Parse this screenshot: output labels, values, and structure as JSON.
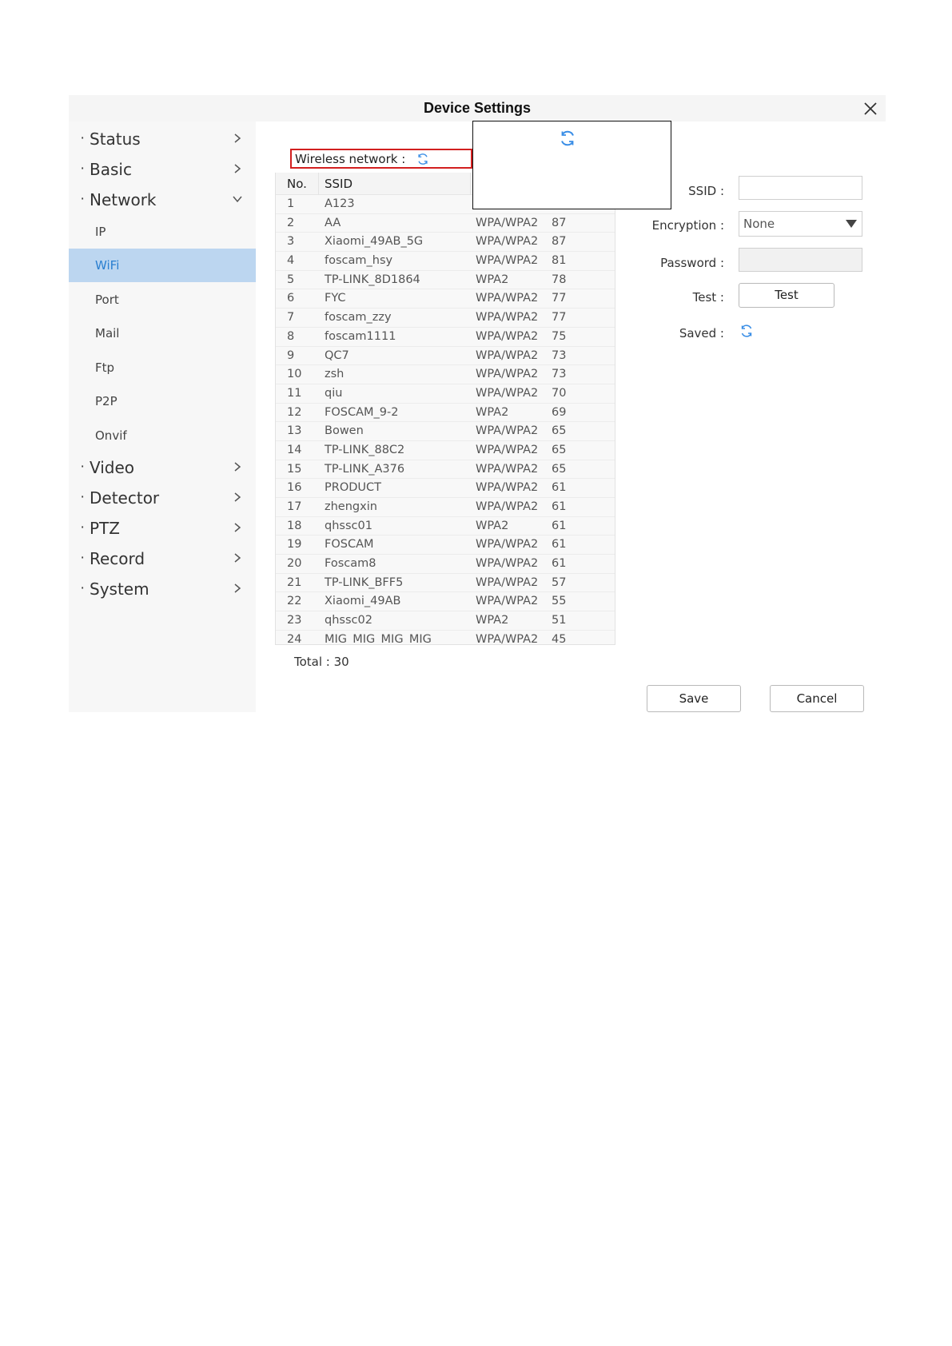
{
  "window": {
    "title": "Device Settings"
  },
  "sidebar": {
    "items": [
      {
        "label": "Status"
      },
      {
        "label": "Basic"
      },
      {
        "label": "Network"
      },
      {
        "label": "Video"
      },
      {
        "label": "Detector"
      },
      {
        "label": "PTZ"
      },
      {
        "label": "Record"
      },
      {
        "label": "System"
      }
    ],
    "network_sub": [
      {
        "label": "IP"
      },
      {
        "label": "WiFi"
      },
      {
        "label": "Port"
      },
      {
        "label": "Mail"
      },
      {
        "label": "Ftp"
      },
      {
        "label": "P2P"
      },
      {
        "label": "Onvif"
      }
    ]
  },
  "wifi": {
    "wireless_label": "Wireless network :",
    "table": {
      "headers": {
        "no": "No.",
        "ssid": "SSID"
      },
      "rows": [
        {
          "no": "1",
          "ssid": "A123",
          "enc": "",
          "sig": ""
        },
        {
          "no": "2",
          "ssid": "AA",
          "enc": "WPA/WPA2",
          "sig": "87"
        },
        {
          "no": "3",
          "ssid": "Xiaomi_49AB_5G",
          "enc": "WPA/WPA2",
          "sig": "87"
        },
        {
          "no": "4",
          "ssid": "foscam_hsy",
          "enc": "WPA/WPA2",
          "sig": "81"
        },
        {
          "no": "5",
          "ssid": "TP-LINK_8D1864",
          "enc": "WPA2",
          "sig": "78"
        },
        {
          "no": "6",
          "ssid": "FYC",
          "enc": "WPA/WPA2",
          "sig": "77"
        },
        {
          "no": "7",
          "ssid": "foscam_zzy",
          "enc": "WPA/WPA2",
          "sig": "77"
        },
        {
          "no": "8",
          "ssid": "foscam1111",
          "enc": "WPA/WPA2",
          "sig": "75"
        },
        {
          "no": "9",
          "ssid": "QC7",
          "enc": "WPA/WPA2",
          "sig": "73"
        },
        {
          "no": "10",
          "ssid": "zsh",
          "enc": "WPA/WPA2",
          "sig": "73"
        },
        {
          "no": "11",
          "ssid": "qiu",
          "enc": "WPA/WPA2",
          "sig": "70"
        },
        {
          "no": "12",
          "ssid": "FOSCAM_9-2",
          "enc": "WPA2",
          "sig": "69"
        },
        {
          "no": "13",
          "ssid": "Bowen",
          "enc": "WPA/WPA2",
          "sig": "65"
        },
        {
          "no": "14",
          "ssid": "TP-LINK_88C2",
          "enc": "WPA/WPA2",
          "sig": "65"
        },
        {
          "no": "15",
          "ssid": "TP-LINK_A376",
          "enc": "WPA/WPA2",
          "sig": "65"
        },
        {
          "no": "16",
          "ssid": "PRODUCT",
          "enc": "WPA/WPA2",
          "sig": "61"
        },
        {
          "no": "17",
          "ssid": "zhengxin",
          "enc": "WPA/WPA2",
          "sig": "61"
        },
        {
          "no": "18",
          "ssid": "qhssc01",
          "enc": "WPA2",
          "sig": "61"
        },
        {
          "no": "19",
          "ssid": "FOSCAM",
          "enc": "WPA/WPA2",
          "sig": "61"
        },
        {
          "no": "20",
          "ssid": "Foscam8",
          "enc": "WPA/WPA2",
          "sig": "61"
        },
        {
          "no": "21",
          "ssid": "TP-LINK_BFF5",
          "enc": "WPA/WPA2",
          "sig": "57"
        },
        {
          "no": "22",
          "ssid": "Xiaomi_49AB",
          "enc": "WPA/WPA2",
          "sig": "55"
        },
        {
          "no": "23",
          "ssid": "qhssc02",
          "enc": "WPA2",
          "sig": "51"
        },
        {
          "no": "24",
          "ssid": "MIG_MIG_MIG_MIG",
          "enc": "WPA/WPA2",
          "sig": "45"
        }
      ]
    },
    "total": "Total : 30",
    "form": {
      "ssid_label": "SSID :",
      "ssid_value": "",
      "encryption_label": "Encryption :",
      "encryption_value": "None",
      "password_label": "Password :",
      "test_label": "Test :",
      "test_button": "Test",
      "saved_label": "Saved :"
    },
    "save_button": "Save",
    "cancel_button": "Cancel"
  },
  "colors": {
    "accent": "#2a7fd0",
    "active_bg": "#bcd6f0",
    "highlight": "#d21f1f"
  }
}
